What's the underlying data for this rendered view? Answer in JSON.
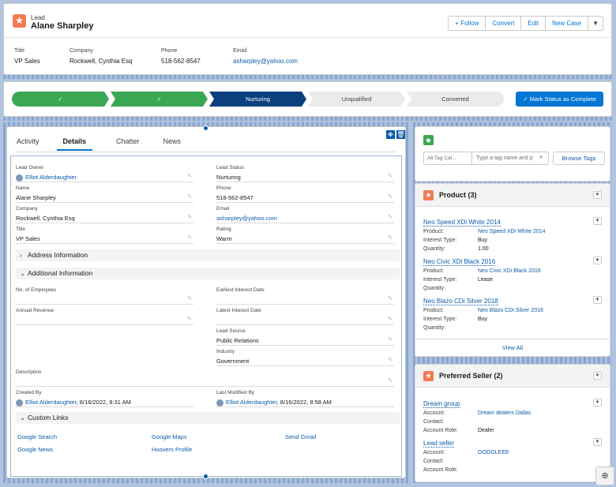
{
  "header": {
    "record_type": "Lead",
    "record_name": "Alane Sharpley",
    "buttons": [
      "+ Follow",
      "Convert",
      "Edit",
      "New Case",
      "▼"
    ],
    "fields": [
      {
        "label": "Title",
        "value": "VP Sales"
      },
      {
        "label": "Company",
        "value": "Rockwell, Cynthia Esq"
      },
      {
        "label": "Phone",
        "value": "518-562-8547"
      },
      {
        "label": "Email",
        "value": "asharpley@yahoo.com"
      }
    ]
  },
  "path": {
    "steps": [
      "✓",
      "✓",
      "Nurturing",
      "Unqualified",
      "Converted"
    ],
    "mark_button": "✓ Mark Status as Complete"
  },
  "tabs": [
    "Activity",
    "Details",
    "Chatter",
    "News"
  ],
  "details": {
    "lead_owner_label": "Lead Owner",
    "lead_owner": "Elliot Alderdaughter",
    "lead_status_label": "Lead Status",
    "lead_status": "Nurturing",
    "name_label": "Name",
    "name": "Alane Sharpley",
    "phone_label": "Phone",
    "phone": "518-562-8547",
    "company_label": "Company",
    "company": "Rockwell, Cynthia Esq",
    "email_label": "Email",
    "email": "asharpley@yahoo.com",
    "title_label": "Title",
    "title": "VP Sales",
    "rating_label": "Rating",
    "rating": "Warm",
    "address_section": "Address Information",
    "additional_section": "Additional Information",
    "employees_label": "No. of Employees",
    "earliest_label": "Earliest Interest Date",
    "revenue_label": "Annual Revenue",
    "latest_label": "Latest Interest Date",
    "source_label": "Lead Source",
    "source": "Public Relations",
    "industry_label": "Industry",
    "industry": "Government",
    "description_label": "Description",
    "created_label": "Created By",
    "created_by": "Elliot Alderdaughter",
    "created_date": ", 8/16/2022, 8:31 AM",
    "modified_label": "Last Modified By",
    "modified_by": "Elliot Alderdaughter",
    "modified_date": ", 8/16/2022, 8:58 AM",
    "custom_section": "Custom Links",
    "custom_links": [
      "Google Search",
      "Google Maps",
      "Send Gmail",
      "Google News",
      "Hoovers Profile"
    ]
  },
  "tags": {
    "category_placeholder": "All Tag Cat...",
    "input_placeholder": "Type a tag name and p",
    "browse": "Browse Tags"
  },
  "products": {
    "title": "Product (3)",
    "items": [
      {
        "name": "Neo Speed XDi White 2014",
        "product": "Neo Speed XDi White 2014",
        "interest_type": "Buy",
        "quantity": "1.00"
      },
      {
        "name": "Neo Civic XDi Black 2016",
        "product": "Neo Civic XDi Black 2016",
        "interest_type": "Lease",
        "quantity": ""
      },
      {
        "name": "Neo Blazo CDi Silver 2018",
        "product": "Neo Blazo CDi Silver 2018",
        "interest_type": "Buy",
        "quantity": ""
      }
    ],
    "labels": {
      "product": "Product:",
      "interest": "Interest Type:",
      "quantity": "Quantity:"
    },
    "view_all": "View All"
  },
  "sellers": {
    "title": "Preferred Seller (2)",
    "items": [
      {
        "name": "Dream group",
        "account": "Dream dealers Dallas",
        "contact": "",
        "role": "Dealer"
      },
      {
        "name": "Lead seller",
        "account": "OOOGLEEE",
        "contact": "",
        "role": ""
      }
    ],
    "labels": {
      "account": "Account:",
      "contact": "Contact:",
      "role": "Account Role:"
    }
  },
  "colors": {
    "brand": "#0176d3",
    "complete": "#3ba755",
    "current": "#0b3f7e",
    "lead_icon": "#f07c53"
  }
}
